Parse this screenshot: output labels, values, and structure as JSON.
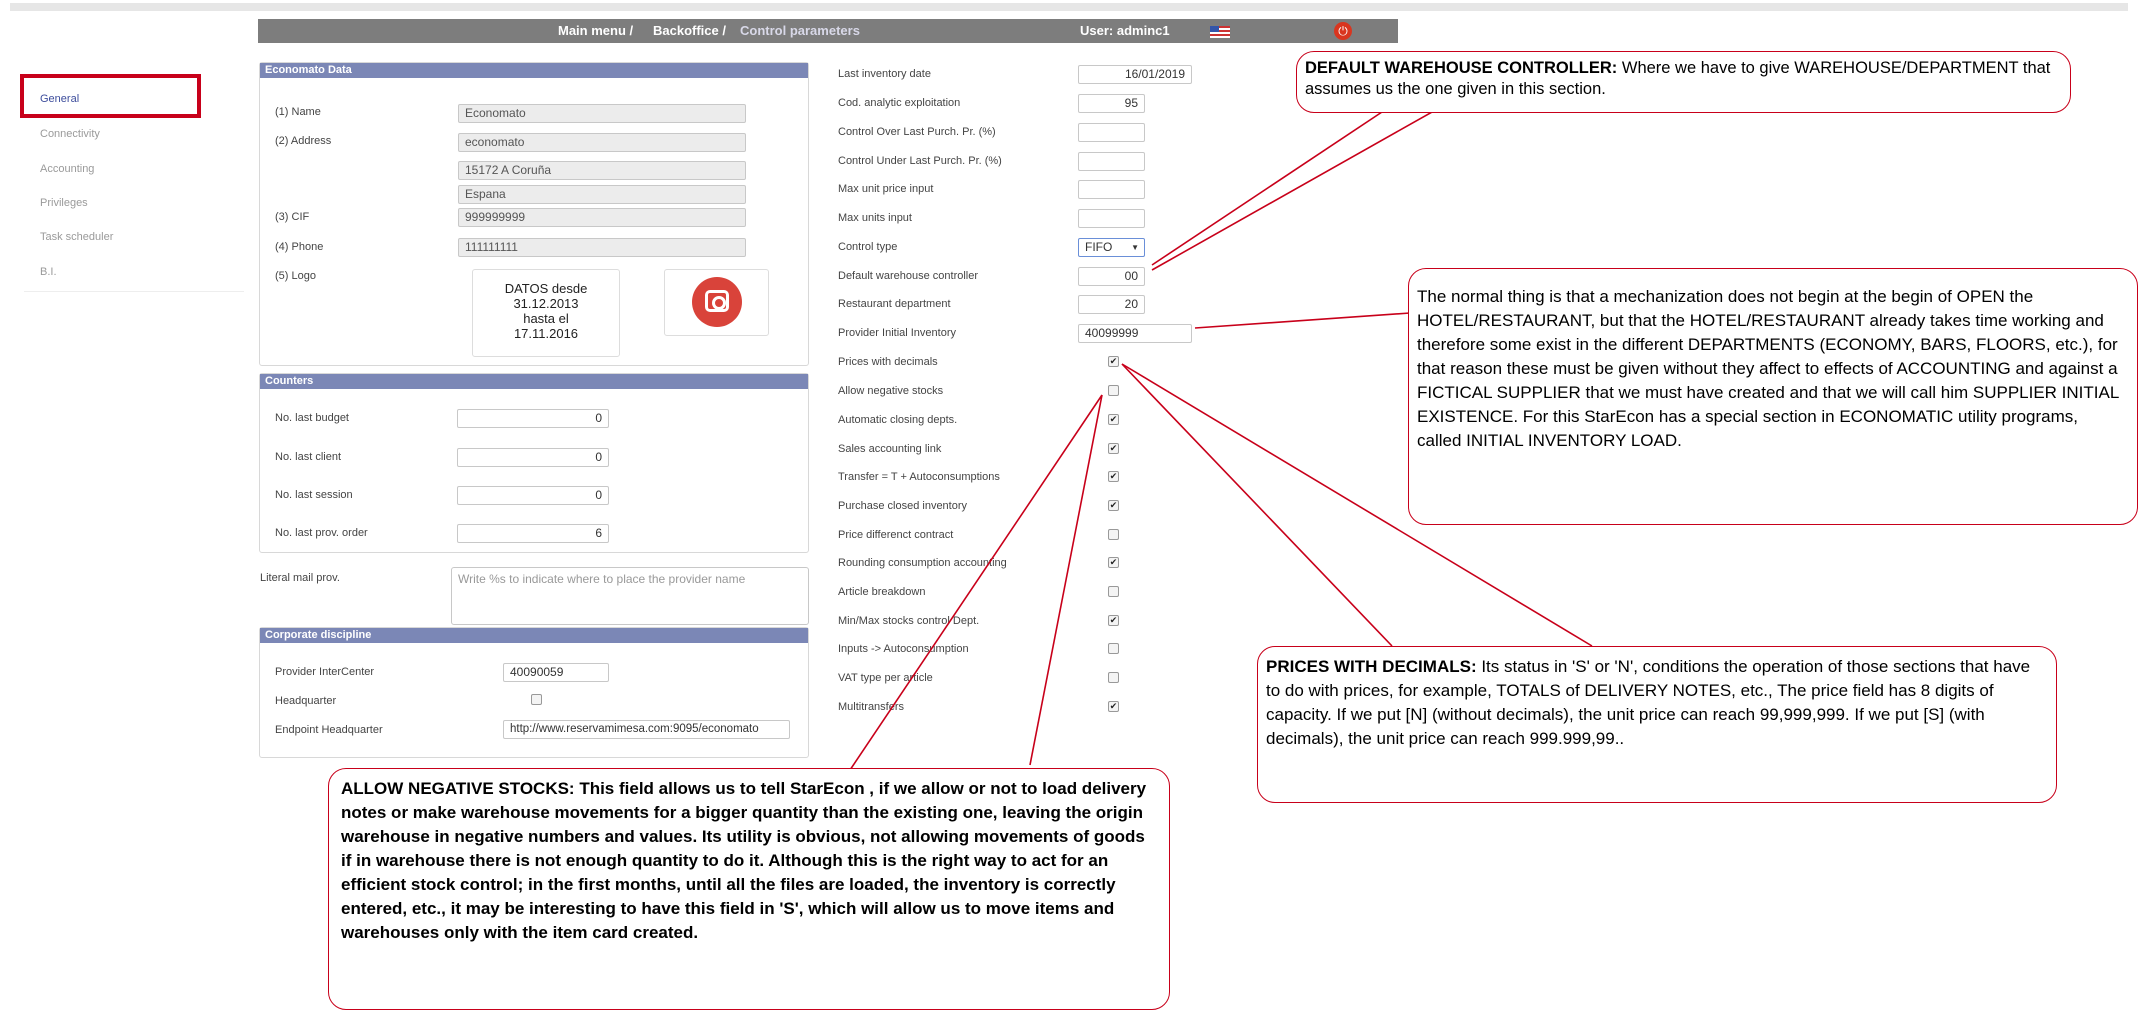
{
  "header": {
    "breadcrumb_main": "Main menu /",
    "breadcrumb_backoffice": "Backoffice /",
    "breadcrumb_current": "Control parameters",
    "user": "User: adminc1"
  },
  "sidebar": {
    "items": [
      {
        "label": "General"
      },
      {
        "label": "Connectivity"
      },
      {
        "label": "Accounting"
      },
      {
        "label": "Privileges"
      },
      {
        "label": "Task scheduler"
      },
      {
        "label": "B.I."
      }
    ]
  },
  "economato": {
    "title": "Economato Data",
    "name_label": "(1) Name",
    "name_value": "Economato",
    "address_label": "(2) Address",
    "address_line1": "economato",
    "address_line2": "15172 A Coruña",
    "address_line3": "Espana",
    "cif_label": "(3) CIF",
    "cif_value": "999999999",
    "phone_label": "(4) Phone",
    "phone_value": "111111111",
    "logo_label": "(5) Logo",
    "logo_text": [
      "DATOS desde",
      "31.12.2013",
      "hasta el",
      "17.11.2016"
    ]
  },
  "counters": {
    "title": "Counters",
    "rows": [
      {
        "label": "No. last budget",
        "value": "0"
      },
      {
        "label": "No. last client",
        "value": "0"
      },
      {
        "label": "No. last session",
        "value": "0"
      },
      {
        "label": "No. last prov. order",
        "value": "6"
      }
    ]
  },
  "literal_mail": {
    "label": "Literal mail prov.",
    "placeholder": "Write %s to indicate where to place the provider name"
  },
  "corporate": {
    "title": "Corporate discipline",
    "intercenter_label": "Provider InterCenter",
    "intercenter_value": "40090059",
    "headquarter_label": "Headquarter",
    "endpoint_label": "Endpoint Headquarter",
    "endpoint_value": "http://www.reservamimesa.com:9095/economato"
  },
  "params": {
    "fields": [
      {
        "label": "Last inventory date",
        "value": "16/01/2019"
      },
      {
        "label": "Cod. analytic exploitation",
        "value": "95"
      },
      {
        "label": "Control Over Last Purch. Pr. (%)",
        "value": ""
      },
      {
        "label": "Control Under Last Purch. Pr. (%)",
        "value": ""
      },
      {
        "label": "Max unit price input",
        "value": ""
      },
      {
        "label": "Max units input",
        "value": ""
      },
      {
        "label": "Control type",
        "value": "FIFO"
      },
      {
        "label": "Default warehouse controller",
        "value": "00"
      },
      {
        "label": "Restaurant department",
        "value": "20"
      },
      {
        "label": "Provider Initial Inventory",
        "value": "40099999"
      }
    ],
    "checks": [
      {
        "label": "Prices with decimals",
        "checked": true
      },
      {
        "label": "Allow negative stocks",
        "checked": false
      },
      {
        "label": "Automatic closing depts.",
        "checked": true
      },
      {
        "label": "Sales accounting link",
        "checked": true
      },
      {
        "label": "Transfer = T + Autoconsumptions",
        "checked": true
      },
      {
        "label": "Purchase closed inventory",
        "checked": true
      },
      {
        "label": "Price differenct contract",
        "checked": false
      },
      {
        "label": "Rounding consumption accounting",
        "checked": true
      },
      {
        "label": "Article breakdown",
        "checked": false
      },
      {
        "label": "Min/Max stocks control Dept.",
        "checked": true
      },
      {
        "label": "Inputs -> Autoconsumption",
        "checked": false
      },
      {
        "label": "VAT type per article",
        "checked": false
      },
      {
        "label": "Multitransfers",
        "checked": true
      }
    ]
  },
  "annotations": {
    "warehouse_title": "DEFAULT WAREHOUSE CONTROLLER:",
    "warehouse_text": " Where we have to give WAREHOUSE/DEPARTMENT that assumes us the one given in this section.",
    "initial_text": "The normal thing is that a mechanization does not begin at the begin of OPEN the HOTEL/RESTAURANT, but that the HOTEL/RESTAURANT already takes time working and therefore some exist in the different DEPARTMENTS (ECONOMY, BARS, FLOORS, etc.), for that reason these must be given without they affect to effects of ACCOUNTING and against a FICTICAL SUPPLIER that we must have created and that we will call him SUPPLIER INITIAL EXISTENCE. For this StarEcon has a special section in ECONOMATIC utility programs, called INITIAL INVENTORY LOAD.",
    "decimals_title": "PRICES WITH DECIMALS:",
    "decimals_text": " Its status in 'S' or 'N', conditions the operation of those sections that have to do with prices, for example, TOTALS of DELIVERY NOTES, etc., The price field has 8 digits of capacity. If we put [N] (without decimals), the unit price can reach 99,999,999. If we put [S] (with decimals), the unit price can reach 999.999,99..",
    "negative_text": "ALLOW NEGATIVE STOCKS: This field allows us to tell StarEcon , if we allow or not to load delivery notes or make warehouse movements for a bigger quantity than the existing one, leaving the origin warehouse in negative numbers and values. Its utility is obvious, not allowing movements of goods if in warehouse there is not enough quantity to do it. Although this is the right way to act for an efficient stock control; in the first months, until all the files are loaded, the inventory is correctly entered, etc., it may be interesting to have this field in 'S', which will allow us to move items and warehouses only with the item card created."
  },
  "colors": {
    "accent": "#7b87b6",
    "annotation_border": "#c8001a",
    "navbar": "#7d7d7d"
  }
}
